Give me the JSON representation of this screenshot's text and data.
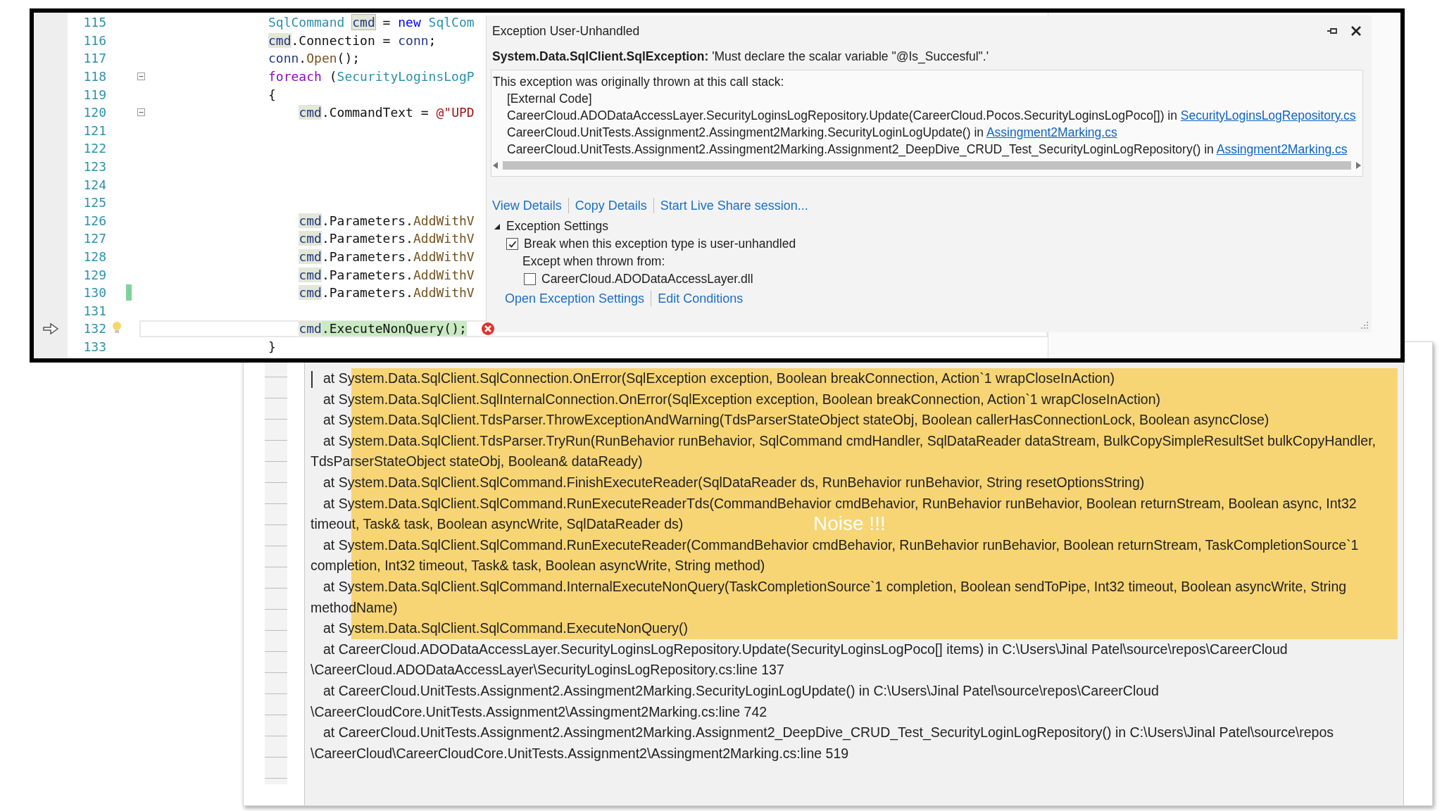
{
  "editor": {
    "lines": [
      {
        "number": "115",
        "kind": "outer",
        "fold": false,
        "changed": false,
        "current": false,
        "error": false,
        "tokens": [
          {
            "text": "SqlCommand ",
            "kind": "type"
          },
          {
            "text": "cmd",
            "kind": "def"
          },
          {
            "text": " = ",
            "kind": "plain"
          },
          {
            "text": "new ",
            "kind": "keyword"
          },
          {
            "text": "SqlCom",
            "kind": "type"
          }
        ]
      },
      {
        "number": "116",
        "kind": "outer",
        "fold": false,
        "changed": false,
        "current": false,
        "error": false,
        "tokens": [
          {
            "text": "cmd",
            "kind": "ref"
          },
          {
            "text": ".Connection = ",
            "kind": "plain"
          },
          {
            "text": "conn",
            "kind": "var"
          },
          {
            "text": ";",
            "kind": "plain"
          }
        ]
      },
      {
        "number": "117",
        "kind": "outer",
        "fold": false,
        "changed": false,
        "current": false,
        "error": false,
        "tokens": [
          {
            "text": "conn",
            "kind": "var"
          },
          {
            "text": ".",
            "kind": "plain"
          },
          {
            "text": "Open",
            "kind": "method"
          },
          {
            "text": "();",
            "kind": "plain"
          }
        ]
      },
      {
        "number": "118",
        "kind": "outer",
        "fold": true,
        "changed": false,
        "current": false,
        "error": false,
        "tokens": [
          {
            "text": "foreach ",
            "kind": "control"
          },
          {
            "text": "(",
            "kind": "plain"
          },
          {
            "text": "SecurityLoginsLogP",
            "kind": "type"
          }
        ]
      },
      {
        "number": "119",
        "kind": "outer",
        "fold": false,
        "changed": false,
        "current": false,
        "error": false,
        "tokens": [
          {
            "text": "{",
            "kind": "plain"
          }
        ]
      },
      {
        "number": "120",
        "kind": "inner",
        "fold": true,
        "changed": false,
        "current": false,
        "error": false,
        "tokens": [
          {
            "text": "cmd",
            "kind": "ref"
          },
          {
            "text": ".CommandText = ",
            "kind": "plain"
          },
          {
            "text": "@\"UPD",
            "kind": "string"
          }
        ]
      },
      {
        "number": "121",
        "kind": "inner",
        "fold": false,
        "changed": false,
        "current": false,
        "error": false
      },
      {
        "number": "122",
        "kind": "inner",
        "fold": false,
        "changed": false,
        "current": false,
        "error": false
      },
      {
        "number": "123",
        "kind": "inner",
        "fold": false,
        "changed": false,
        "current": false,
        "error": false
      },
      {
        "number": "124",
        "kind": "inner",
        "fold": false,
        "changed": false,
        "current": false,
        "error": false
      },
      {
        "number": "125",
        "kind": "inner",
        "fold": false,
        "changed": false,
        "current": false,
        "error": false
      },
      {
        "number": "126",
        "kind": "inner",
        "fold": false,
        "changed": false,
        "current": false,
        "error": false,
        "tokens": [
          {
            "text": "cmd",
            "kind": "ref"
          },
          {
            "text": ".Parameters.",
            "kind": "plain"
          },
          {
            "text": "AddWithV",
            "kind": "method"
          }
        ]
      },
      {
        "number": "127",
        "kind": "inner",
        "fold": false,
        "changed": false,
        "current": false,
        "error": false,
        "tokens": [
          {
            "text": "cmd",
            "kind": "ref"
          },
          {
            "text": ".Parameters.",
            "kind": "plain"
          },
          {
            "text": "AddWithV",
            "kind": "method"
          }
        ]
      },
      {
        "number": "128",
        "kind": "inner",
        "fold": false,
        "changed": false,
        "current": false,
        "error": false,
        "tokens": [
          {
            "text": "cmd",
            "kind": "ref"
          },
          {
            "text": ".Parameters.",
            "kind": "plain"
          },
          {
            "text": "AddWithV",
            "kind": "method"
          }
        ]
      },
      {
        "number": "129",
        "kind": "inner",
        "fold": false,
        "changed": false,
        "current": false,
        "error": false,
        "tokens": [
          {
            "text": "cmd",
            "kind": "ref"
          },
          {
            "text": ".Parameters.",
            "kind": "plain"
          },
          {
            "text": "AddWithV",
            "kind": "method"
          }
        ]
      },
      {
        "number": "130",
        "kind": "inner",
        "fold": false,
        "changed": true,
        "current": false,
        "error": false,
        "tokens": [
          {
            "text": "cmd",
            "kind": "ref"
          },
          {
            "text": ".Parameters.",
            "kind": "plain"
          },
          {
            "text": "AddWithV",
            "kind": "method"
          }
        ]
      },
      {
        "number": "131",
        "kind": "inner",
        "fold": false,
        "changed": false,
        "current": false,
        "error": false
      },
      {
        "number": "132",
        "kind": "inner",
        "fold": false,
        "changed": false,
        "current": true,
        "error": true,
        "tokens": [
          {
            "text": "cmd",
            "kind": "ref"
          },
          {
            "text": ".ExecuteNonQuery();",
            "kind": "statement"
          }
        ]
      },
      {
        "number": "133",
        "kind": "outer",
        "fold": false,
        "changed": false,
        "current": false,
        "error": false,
        "tokens": [
          {
            "text": "}",
            "kind": "plain"
          }
        ]
      }
    ]
  },
  "exception_popup": {
    "title": "Exception User-Unhandled",
    "message": "**System.Data.SqlClient.SqlException:** 'Must declare the scalar variable \"@Is_Succesful\".'",
    "call_stack": {
      "heading": "This exception was originally thrown at this call stack:",
      "frames": [
        {
          "text": "[External Code]"
        },
        {
          "text": "CareerCloud.ADODataAccessLayer.SecurityLoginsLogRepository.Update(CareerCloud.Pocos.SecurityLoginsLogPoco[]) in ",
          "file": "SecurityLoginsLogRepository.cs"
        },
        {
          "text": "CareerCloud.UnitTests.Assignment2.Assingment2Marking.SecurityLoginLogUpdate() in ",
          "file": "Assingment2Marking.cs"
        },
        {
          "text": "CareerCloud.UnitTests.Assignment2.Assingment2Marking.Assignment2_DeepDive_CRUD_Test_SecurityLoginLogRepository() in ",
          "file": "Assingment2Marking.cs"
        }
      ]
    },
    "links": [
      "View Details",
      "Copy Details",
      "Start Live Share session..."
    ],
    "settings": {
      "title": "Exception Settings",
      "expanded": true,
      "break_option": {
        "label": "Break when this exception type is user-unhandled",
        "checked": true
      },
      "except_label": "Except when thrown from:",
      "modules": [
        {
          "label": "CareerCloud.ADODataAccessLayer.dll",
          "checked": false
        }
      ],
      "links": [
        "Open Exception Settings",
        "Edit Conditions"
      ]
    }
  },
  "stack_trace": {
    "annotation": "Noise !!!",
    "entries": [
      {
        "text": "at System.Data.SqlClient.SqlConnection.OnError(SqlException exception, Boolean breakConnection, Action`1 wrapCloseInAction)",
        "highlighted": true
      },
      {
        "text": "at System.Data.SqlClient.SqlInternalConnection.OnError(SqlException exception, Boolean breakConnection, Action`1 wrapCloseInAction)",
        "highlighted": true
      },
      {
        "text": "at System.Data.SqlClient.TdsParser.ThrowExceptionAndWarning(TdsParserStateObject stateObj, Boolean callerHasConnectionLock, Boolean asyncClose)",
        "highlighted": true
      },
      {
        "text": "at System.Data.SqlClient.TdsParser.TryRun(RunBehavior runBehavior, SqlCommand cmdHandler, SqlDataReader dataStream, BulkCopySimpleResultSet bulkCopyHandler, TdsParserStateObject stateObj, Boolean& dataReady)",
        "highlighted": true
      },
      {
        "text": "at System.Data.SqlClient.SqlCommand.FinishExecuteReader(SqlDataReader ds, RunBehavior runBehavior, String resetOptionsString)",
        "highlighted": true
      },
      {
        "text": "at System.Data.SqlClient.SqlCommand.RunExecuteReaderTds(CommandBehavior cmdBehavior, RunBehavior runBehavior, Boolean returnStream, Boolean async, Int32 timeout, Task& task, Boolean asyncWrite, SqlDataReader ds)",
        "highlighted": true
      },
      {
        "text": "at System.Data.SqlClient.SqlCommand.RunExecuteReader(CommandBehavior cmdBehavior, RunBehavior runBehavior, Boolean returnStream, TaskCompletionSource`1 completion, Int32 timeout, Task& task, Boolean asyncWrite, String method)",
        "highlighted": true
      },
      {
        "text": "at System.Data.SqlClient.SqlCommand.InternalExecuteNonQuery(TaskCompletionSource`1 completion, Boolean sendToPipe, Int32 timeout, Boolean asyncWrite, String methodName)",
        "highlighted": true
      },
      {
        "text": "at System.Data.SqlClient.SqlCommand.ExecuteNonQuery()",
        "highlighted": true
      },
      {
        "text": "at CareerCloud.ADODataAccessLayer.SecurityLoginsLogRepository.Update(SecurityLoginsLogPoco[] items) in C:\\Users\\Jinal Patel\\source\\repos\\CareerCloud \\CareerCloud.ADODataAccessLayer\\SecurityLoginsLogRepository.cs:line 137",
        "highlighted": false
      },
      {
        "text": "at CareerCloud.UnitTests.Assignment2.Assingment2Marking.SecurityLoginLogUpdate() in C:\\Users\\Jinal Patel\\source\\repos\\CareerCloud \\CareerCloudCore.UnitTests.Assignment2\\Assingment2Marking.cs:line 742",
        "highlighted": false
      },
      {
        "text": "at CareerCloud.UnitTests.Assignment2.Assingment2Marking.Assignment2_DeepDive_CRUD_Test_SecurityLoginLogRepository() in C:\\Users\\Jinal Patel\\source\\repos \\CareerCloud\\CareerCloudCore.UnitTests.Assignment2\\Assingment2Marking.cs:line 519",
        "highlighted": false
      }
    ]
  }
}
